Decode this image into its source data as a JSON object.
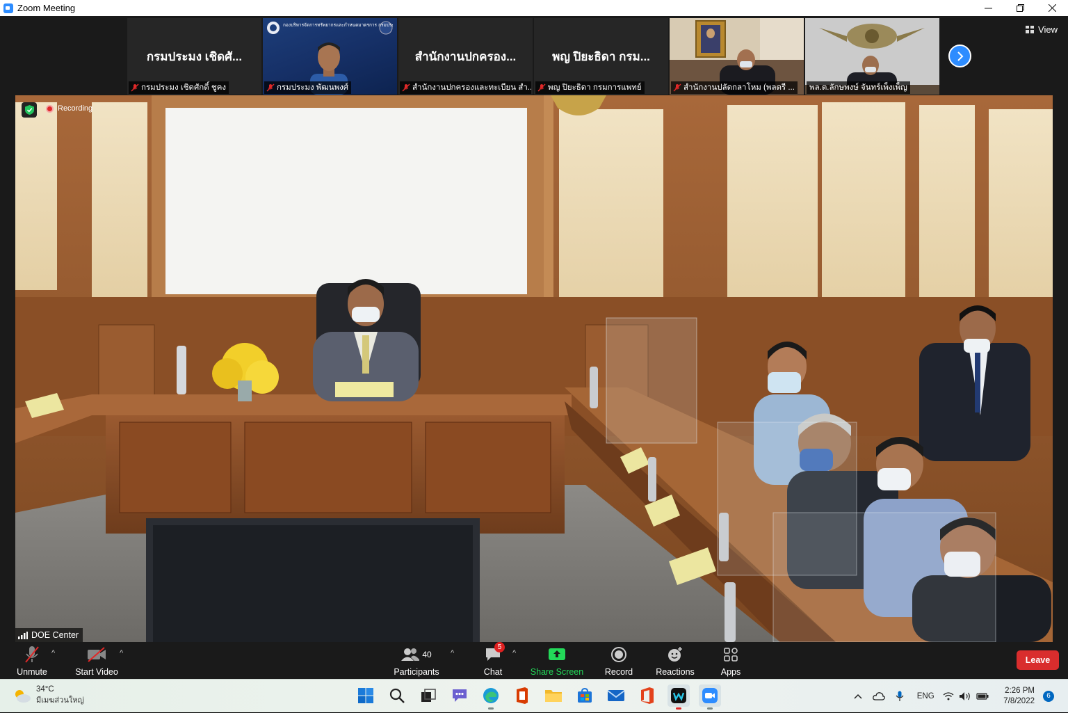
{
  "window": {
    "title": "Zoom Meeting",
    "minimize": "—",
    "maximize": "❐",
    "close": "✕"
  },
  "strip": {
    "thumbs": [
      {
        "big_name": "กรมประมง เชิดศั...",
        "label": "กรมประมง เชิดศักดิ์ ชูคง",
        "muted": true,
        "kind": "name"
      },
      {
        "big_name": "",
        "label": "กรมประมง พัฒนพงศ์",
        "muted": true,
        "kind": "video1",
        "banner": "กองบริหารจัดการทรัพยากรและกำหนดมาตรการ กรมประมง"
      },
      {
        "big_name": "สำนักงานปกครอง...",
        "label": "สำนักงานปกครองและทะเบียน สำ...",
        "muted": true,
        "kind": "name"
      },
      {
        "big_name": "พญ ปิยะธิดา กรม...",
        "label": "พญ ปิยะธิดา กรมการแพทย์",
        "muted": true,
        "kind": "name"
      },
      {
        "big_name": "",
        "label": "สำนักงานปลัดกลาโหม (พลตรี ...",
        "muted": true,
        "kind": "video2"
      },
      {
        "big_name": "",
        "label": "พล.ต.ลักษพงษ์ จันทร์เพ็งเพ็ญ",
        "muted": false,
        "kind": "video3"
      }
    ],
    "view_label": "View"
  },
  "main": {
    "recording_label": "Recording",
    "speaker_name": "DOE Center"
  },
  "toolbar": {
    "unmute": "Unmute",
    "start_video": "Start Video",
    "participants": "Participants",
    "participants_count": "40",
    "chat": "Chat",
    "chat_badge": "5",
    "share_screen": "Share Screen",
    "record": "Record",
    "reactions": "Reactions",
    "apps": "Apps",
    "leave": "Leave"
  },
  "taskbar": {
    "weather_temp": "34°C",
    "weather_desc": "มีเมฆส่วนใหญ่",
    "lang": "ENG",
    "time": "2:26 PM",
    "date": "7/8/2022",
    "notifications": "6"
  },
  "colors": {
    "zoom_blue": "#2d8cff",
    "share_green": "#23d959",
    "leave_red": "#d92d2d",
    "mute_red": "#e02828"
  }
}
